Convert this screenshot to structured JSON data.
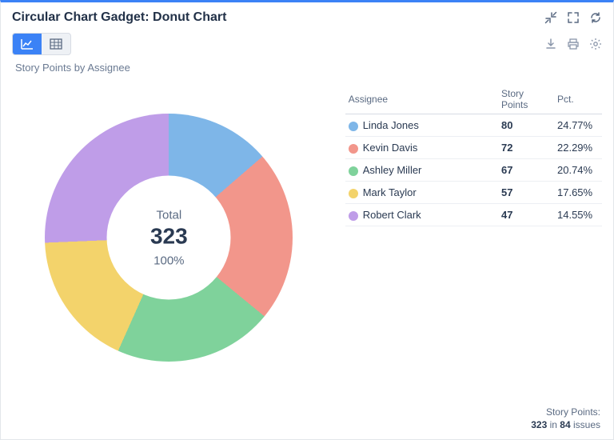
{
  "header": {
    "title": "Circular Chart Gadget: Donut Chart"
  },
  "subtitle": "Story Points by Assignee",
  "center": {
    "label": "Total",
    "value": "323",
    "pct": "100%"
  },
  "legend": {
    "columns": {
      "assignee": "Assignee",
      "points": "Story Points",
      "pct": "Pct."
    }
  },
  "footer": {
    "metric_label": "Story Points:",
    "total": "323",
    "in_label": "in",
    "issues": "84",
    "issues_label": "issues"
  },
  "chart_data": {
    "type": "pie",
    "title": "Story Points by Assignee",
    "total": 323,
    "series": [
      {
        "name": "Linda Jones",
        "value": 80,
        "pct": "24.77%",
        "color": "#7eb6e8"
      },
      {
        "name": "Kevin Davis",
        "value": 72,
        "pct": "22.29%",
        "color": "#f2968b"
      },
      {
        "name": "Ashley Miller",
        "value": 67,
        "pct": "20.74%",
        "color": "#7fd29b"
      },
      {
        "name": "Mark Taylor",
        "value": 57,
        "pct": "17.65%",
        "color": "#f3d36b"
      },
      {
        "name": "Robert Clark",
        "value": 47,
        "pct": "14.55%",
        "color": "#bf9de8"
      }
    ]
  }
}
